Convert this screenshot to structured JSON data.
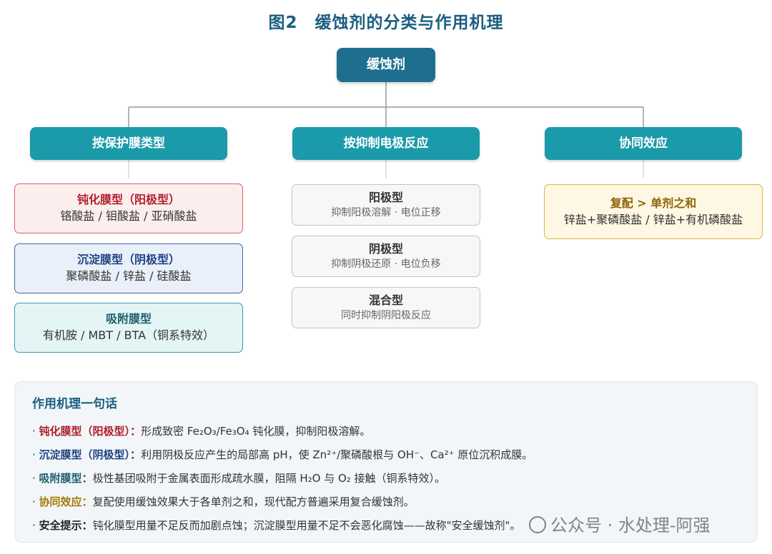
{
  "title": {
    "fig": "图2",
    "text": "缓蚀剂的分类与作用机理"
  },
  "root": "缓蚀剂",
  "categories": [
    {
      "label": "按保护膜类型"
    },
    {
      "label": "按抑制电极反应"
    },
    {
      "label": "协同效应"
    }
  ],
  "film_types": [
    {
      "heading": "钝化膜型（阳极型）",
      "detail": "铬酸盐 / 钼酸盐 / 亚硝酸盐"
    },
    {
      "heading": "沉淀膜型（阴极型）",
      "detail": "聚磷酸盐 / 锌盐 / 硅酸盐"
    },
    {
      "heading": "吸附膜型",
      "detail": "有机胺 / MBT / BTA（铜系特效）"
    }
  ],
  "electrode_types": [
    {
      "heading": "阳极型",
      "detail": "抑制阳极溶解 · 电位正移"
    },
    {
      "heading": "阴极型",
      "detail": "抑制阴极还原 · 电位负移"
    },
    {
      "heading": "混合型",
      "detail": "同时抑制阴阳极反应"
    }
  ],
  "synergy": {
    "heading": "复配 > 单剂之和",
    "detail": "锌盐+聚磷酸盐 / 锌盐+有机磷酸盐"
  },
  "summary": {
    "title": "作用机理一句话",
    "rows": [
      {
        "label": "钝化膜型（阳极型）：",
        "text": "形成致密 Fe₂O₃/Fe₃O₄ 钝化膜，抑制阳极溶解。"
      },
      {
        "label": "沉淀膜型（阴极型）：",
        "text": "利用阴极反应产生的局部高 pH，使 Zn²⁺/聚磷酸根与 OH⁻、Ca²⁺ 原位沉积成膜。"
      },
      {
        "label": "吸附膜型：",
        "text": "极性基团吸附于金属表面形成疏水膜，阻隔 H₂O 与 O₂ 接触（铜系特效）。"
      },
      {
        "label": "协同效应：",
        "text": "复配使用缓蚀效果大于各单剂之和，现代配方普遍采用复合缓蚀剂。"
      },
      {
        "label": "安全提示：",
        "text": "钝化膜型用量不足反而加剧点蚀；沉淀膜型用量不足不会恶化腐蚀——故称\"安全缓蚀剂\"。"
      }
    ]
  },
  "watermark": "公众号 · 水处理-阿强",
  "colors": {
    "title": "#1b5e80",
    "root": "#1e6f8f",
    "category": "#1b9aaa",
    "passivation": "#b01f2c",
    "precipitation": "#1f4282",
    "adsorption": "#1f5f6a",
    "synergy": "#a57a08",
    "connector": "#9a9a9a"
  }
}
